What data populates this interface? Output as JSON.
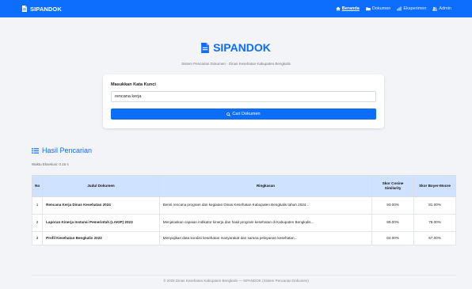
{
  "navbar": {
    "brand": "SIPANDOK",
    "links": [
      {
        "label": "Beranda",
        "icon": "home-icon",
        "active": true
      },
      {
        "label": "Dokumen",
        "icon": "folder-icon",
        "active": false
      },
      {
        "label": "Eksperimen",
        "icon": "chart-icon",
        "active": false
      },
      {
        "label": "Admin",
        "icon": "users-icon",
        "active": false
      }
    ]
  },
  "hero": {
    "title": "SIPANDOK",
    "subtitle": "Sistem Pencarian Dokumen - Dinas Kesehatan Kabupaten Bengkalis"
  },
  "search": {
    "label": "Masukkan Kata Kunci",
    "value": "rencana kerja",
    "button_label": "Cari Dokumen"
  },
  "results": {
    "title": "Hasil Pencarian",
    "exec_time": "Waktu Eksekusi: 0.15 s",
    "headers": {
      "no": "No",
      "title": "Judul Dokumen",
      "summary": "Ringkasan",
      "cosine": "Skor Cosine Similarity",
      "boyer": "Skor Boyer-Moore"
    },
    "rows": [
      {
        "no": "1",
        "title": "Rencana Kerja Dinas Kesehatan 2024",
        "summary": "Berisi rencana program dan kegiatan Dinas Kesehatan Kabupaten Bengkalis tahun 2024...",
        "cosine": "93.00%",
        "boyer": "81.00%"
      },
      {
        "no": "2",
        "title": "Laporan Kinerja Instansi Pemerintah (LAKIP) 2023",
        "summary": "Menjelaskan capaian indikator kinerja dan hasil program kesehatan di Kabupaten Bengkalis...",
        "cosine": "89.00%",
        "boyer": "78.00%"
      },
      {
        "no": "3",
        "title": "Profil Kesehatan Bengkalis 2022",
        "summary": "Menyajikan data kondisi kesehatan masyarakat dan sarana pelayanan kesehatan...",
        "cosine": "84.00%",
        "boyer": "67.00%"
      }
    ]
  },
  "footer": {
    "text": "© 2025 Dinas Kesehatan Kabupaten Bengkalis — SIPANDOK (Sistem Pencarian Dokumen)"
  },
  "colors": {
    "primary": "#0d6efd",
    "table_header": "#cfe2ff",
    "background": "#f2f4f7"
  }
}
